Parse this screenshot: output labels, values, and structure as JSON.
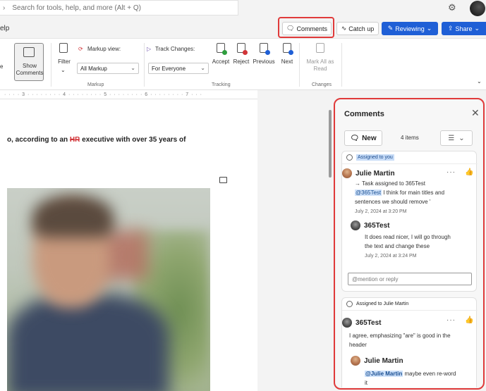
{
  "topbar": {
    "search_placeholder": "Search for tools, help, and more (Alt + Q)"
  },
  "tabs": {
    "help_partial": "elp"
  },
  "actions": {
    "comments_label": "Comments",
    "catchup_label": "Catch up",
    "reviewing_label": "Reviewing",
    "share_label": "Share"
  },
  "ribbon": {
    "show_comments": [
      "Show",
      "Comments"
    ],
    "left_partial": "e",
    "filter_label": "Filter",
    "markup_view_label": "Markup view:",
    "markup_value": "All Markup",
    "markup_group": "Markup",
    "track_changes_label": "Track Changes:",
    "track_value": "For Everyone",
    "accept": "Accept",
    "reject": "Reject",
    "previous": "Previous",
    "next": "Next",
    "tracking_group": "Tracking",
    "mark_all_read": [
      "Mark All as",
      "Read"
    ],
    "changes_group": "Changes"
  },
  "ruler": {
    "text": "· · · · 3 · · · · · · · · 4 · · · · · · · · 5 · · · · · · · · 6 · · · · · · · · 7 · · ·"
  },
  "document": {
    "line_start": "o, according to an ",
    "line_hr": "HR",
    "line_end": " executive with over 35 years of"
  },
  "pane": {
    "title": "Comments",
    "new_label": "New",
    "items_count": "4 items"
  },
  "thread1": {
    "assigned": "Assigned to you",
    "author": "Julie Martin",
    "task_line": "→ Task assigned to 365Test",
    "mention": "@365Test",
    "text_1": " I think for main titles and",
    "text_2": "sentences we should remove '",
    "date": "July 2, 2024 at 3:20 PM",
    "reply_author": "365Test",
    "reply_text_1": "It does read nicer, I will go through",
    "reply_text_2": "the text and change these",
    "reply_date": "July 2, 2024 at 3:24 PM",
    "reply_placeholder": "@mention or reply"
  },
  "thread2": {
    "assigned": "Assigned to Julie Martin",
    "author": "365Test",
    "text_1": "I agree, emphasizing \"are\" is good in the",
    "text_2": "header",
    "reply_author": "Julie Martin",
    "reply_mention": "@Julie Martin",
    "reply_text_1": " maybe even re-word",
    "reply_text_2": "it"
  }
}
